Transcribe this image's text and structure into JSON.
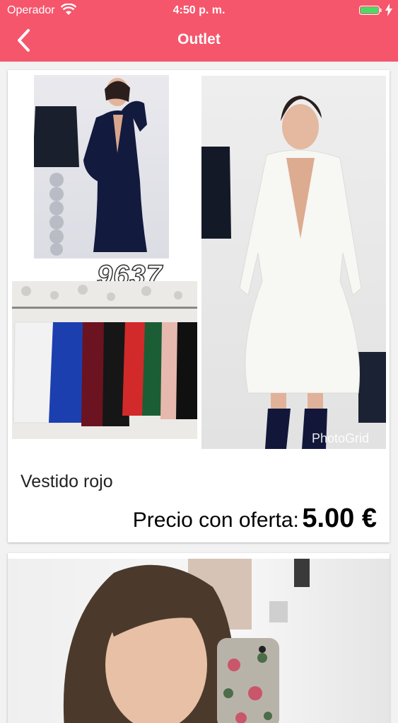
{
  "status_bar": {
    "carrier": "Operador",
    "time": "4:50 p. m.",
    "battery_charging": true
  },
  "nav": {
    "title": "Outlet",
    "back_icon": "chevron-left-icon"
  },
  "theme": {
    "accent": "#f5566c",
    "background": "#f2f2f2"
  },
  "products": [
    {
      "image_code": "9637",
      "watermark": "PhotoGrid",
      "name": "Vestido rojo",
      "price_label": "Precio con oferta:",
      "price_value": "5.00 €"
    },
    {
      "image": "product-photo"
    }
  ]
}
